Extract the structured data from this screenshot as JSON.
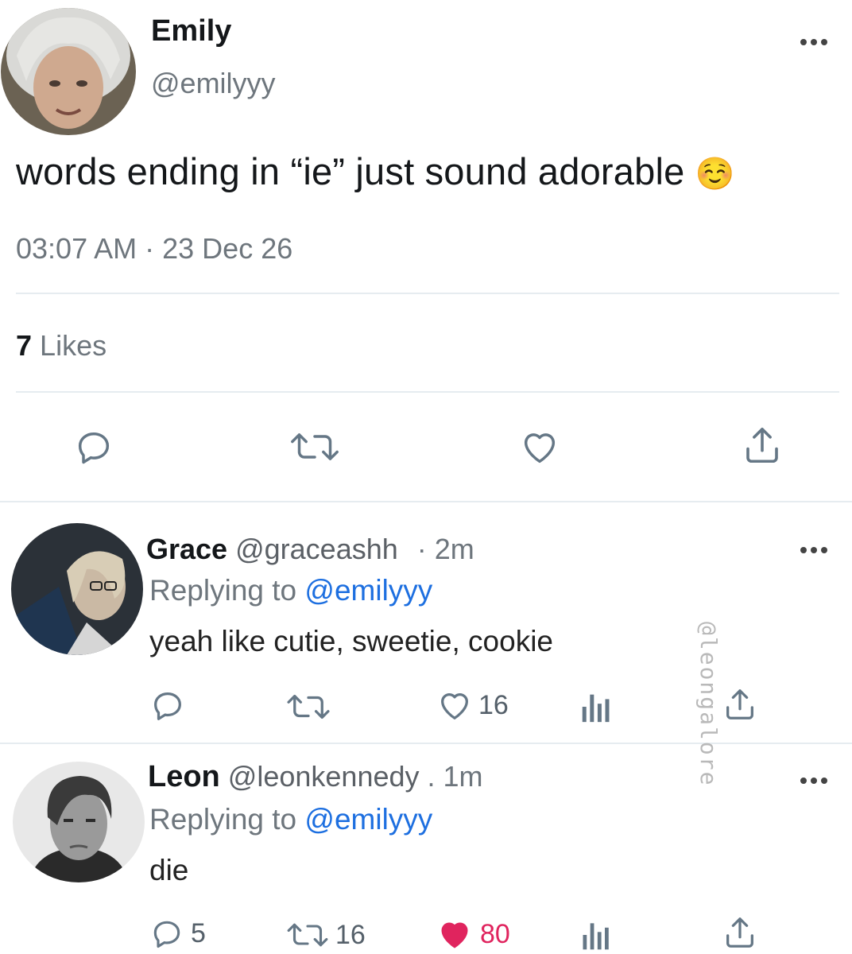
{
  "main_tweet": {
    "display_name": "Emily",
    "handle": "@emilyyy",
    "text": "words ending in “ie” just sound adorable",
    "emoji": "☺️",
    "time": "03:07 AM",
    "separator": "·",
    "date": "23 Dec 26",
    "likes_count": "7",
    "likes_label": "Likes"
  },
  "replies": [
    {
      "display_name": "Grace",
      "handle": "@graceashh",
      "time": "· 2m",
      "replying_label": "Replying to",
      "replying_handle": "@emilyyy",
      "text": "yeah like cutie, sweetie, cookie",
      "like_count": "16"
    },
    {
      "display_name": "Leon",
      "handle": "@leonkennedy",
      "time": ". 1m",
      "replying_label": "Replying to",
      "replying_handle": "@emilyyy",
      "text": "die",
      "reply_count": "5",
      "retweet_count": "16",
      "like_count": "80"
    }
  ],
  "watermark": "@leongalore",
  "colors": {
    "link": "#1d6fe0",
    "liked": "#e0245e",
    "muted": "#6e767d",
    "divider": "#e6ecf0"
  },
  "icons": [
    "more-icon",
    "reply-icon",
    "retweet-icon",
    "like-icon",
    "share-icon",
    "analytics-icon"
  ]
}
